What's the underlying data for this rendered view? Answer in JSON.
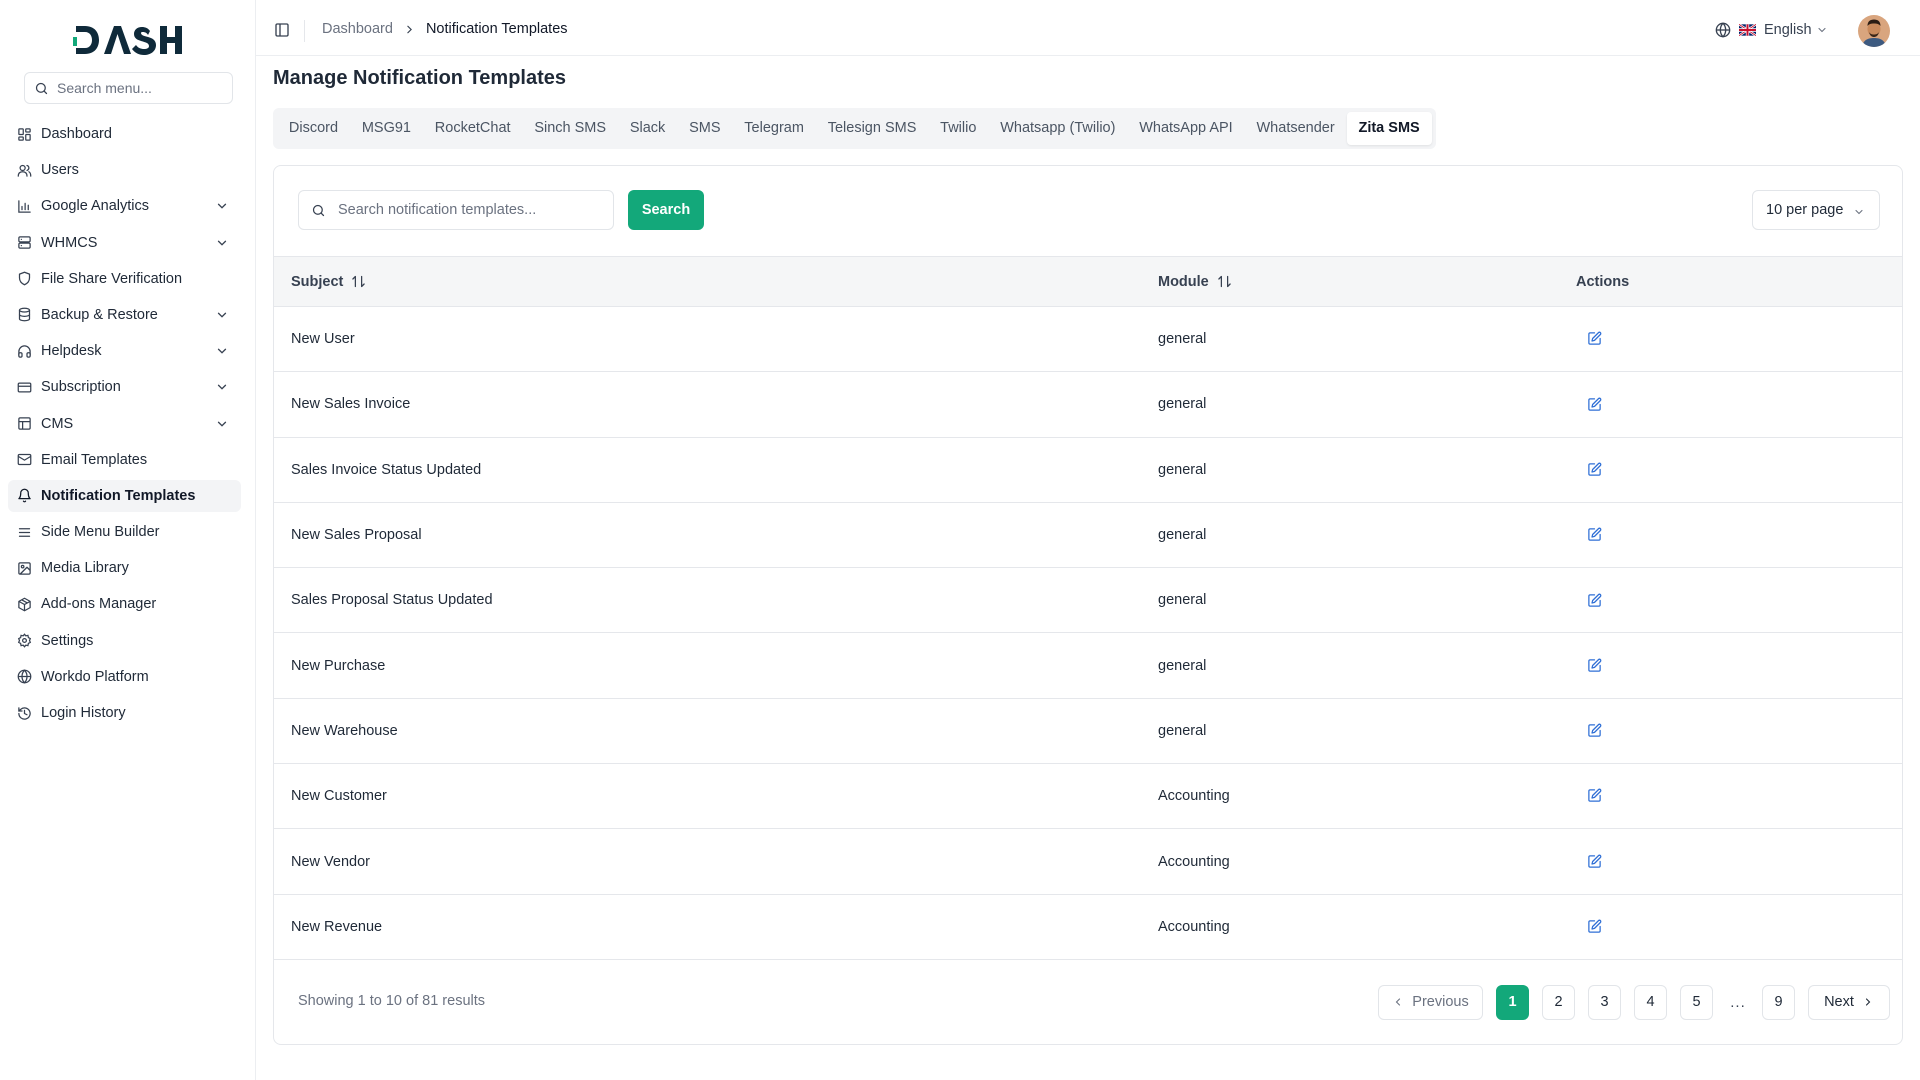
{
  "brand": {
    "logo_text": "DASH",
    "accent": "#13a87a"
  },
  "sidebar": {
    "search_placeholder": "Search menu...",
    "items": [
      {
        "label": "Dashboard",
        "icon": "grid-icon",
        "has_children": false,
        "active": false
      },
      {
        "label": "Users",
        "icon": "users-icon",
        "has_children": false,
        "active": false
      },
      {
        "label": "Google Analytics",
        "icon": "bar-chart-icon",
        "has_children": true,
        "active": false
      },
      {
        "label": "WHMCS",
        "icon": "server-icon",
        "has_children": true,
        "active": false
      },
      {
        "label": "File Share Verification",
        "icon": "shield-icon",
        "has_children": false,
        "active": false
      },
      {
        "label": "Backup & Restore",
        "icon": "database-icon",
        "has_children": true,
        "active": false
      },
      {
        "label": "Helpdesk",
        "icon": "headphones-icon",
        "has_children": true,
        "active": false
      },
      {
        "label": "Subscription",
        "icon": "credit-card-icon",
        "has_children": true,
        "active": false
      },
      {
        "label": "CMS",
        "icon": "layout-icon",
        "has_children": true,
        "active": false
      },
      {
        "label": "Email Templates",
        "icon": "mail-icon",
        "has_children": false,
        "active": false
      },
      {
        "label": "Notification Templates",
        "icon": "bell-icon",
        "has_children": false,
        "active": true
      },
      {
        "label": "Side Menu Builder",
        "icon": "menu-icon",
        "has_children": false,
        "active": false
      },
      {
        "label": "Media Library",
        "icon": "image-icon",
        "has_children": false,
        "active": false
      },
      {
        "label": "Add-ons Manager",
        "icon": "package-icon",
        "has_children": false,
        "active": false
      },
      {
        "label": "Settings",
        "icon": "gear-icon",
        "has_children": false,
        "active": false
      },
      {
        "label": "Workdo Platform",
        "icon": "globe-icon",
        "has_children": false,
        "active": false
      },
      {
        "label": "Login History",
        "icon": "history-icon",
        "has_children": false,
        "active": false
      }
    ]
  },
  "header": {
    "breadcrumb": [
      "Dashboard",
      "Notification Templates"
    ],
    "language": "English"
  },
  "main": {
    "title": "Manage Notification Templates",
    "tabs": [
      {
        "label": "Discord",
        "active": false
      },
      {
        "label": "MSG91",
        "active": false
      },
      {
        "label": "RocketChat",
        "active": false
      },
      {
        "label": "Sinch SMS",
        "active": false
      },
      {
        "label": "Slack",
        "active": false
      },
      {
        "label": "SMS",
        "active": false
      },
      {
        "label": "Telegram",
        "active": false
      },
      {
        "label": "Telesign SMS",
        "active": false
      },
      {
        "label": "Twilio",
        "active": false
      },
      {
        "label": "Whatsapp (Twilio)",
        "active": false
      },
      {
        "label": "WhatsApp API",
        "active": false
      },
      {
        "label": "Whatsender",
        "active": false
      },
      {
        "label": "Zita SMS",
        "active": true
      }
    ],
    "search": {
      "placeholder": "Search notification templates...",
      "button_label": "Search"
    },
    "per_page": "10 per page",
    "table": {
      "columns": [
        "Subject",
        "Module",
        "Actions"
      ],
      "rows": [
        {
          "subject": "New User",
          "module": "general"
        },
        {
          "subject": "New Sales Invoice",
          "module": "general"
        },
        {
          "subject": "Sales Invoice Status Updated",
          "module": "general"
        },
        {
          "subject": "New Sales Proposal",
          "module": "general"
        },
        {
          "subject": "Sales Proposal Status Updated",
          "module": "general"
        },
        {
          "subject": "New Purchase",
          "module": "general"
        },
        {
          "subject": "New Warehouse",
          "module": "general"
        },
        {
          "subject": "New Customer",
          "module": "Accounting"
        },
        {
          "subject": "New Vendor",
          "module": "Accounting"
        },
        {
          "subject": "New Revenue",
          "module": "Accounting"
        }
      ]
    },
    "footer": {
      "showing": "Showing 1 to 10 of 81 results",
      "previous": "Previous",
      "next": "Next",
      "pages": [
        "1",
        "2",
        "3",
        "4",
        "5"
      ],
      "ellipsis": "...",
      "last_page": "9",
      "current_page": "1"
    }
  }
}
